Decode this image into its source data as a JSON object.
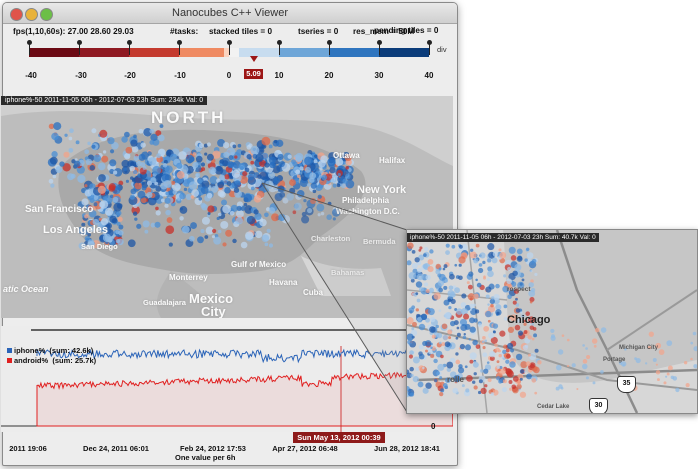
{
  "window": {
    "title": "Nanocubes C++ Viewer"
  },
  "stats": {
    "fps": "fps(1,10,60s): 27.00 28.60 29.03",
    "tasks": "#tasks:",
    "stacked": "stacked tiles = 0",
    "series": "tseries = 0",
    "mem": "res_mem = 50M",
    "pending": "pending tiles = 0"
  },
  "colorbar": {
    "ticks": [
      "-40",
      "-30",
      "-20",
      "-10",
      "0",
      "10",
      "20",
      "30",
      "40"
    ],
    "current_value": "5.09",
    "unit": "div",
    "neg_color": "#6b0a14",
    "pos_color": "#0b3c7a"
  },
  "map": {
    "header": "iphone%-50    2011-11-05 06h - 2012-07-03 23h  Sum: 234k  Val: 0",
    "labels": {
      "north": "NORTH",
      "sf": "San Francisco",
      "la": "Los Angeles",
      "sd": "San Diego",
      "ny": "New York",
      "phil": "Philadelphia",
      "wdc": "Washington D.C.",
      "ottawa": "Ottawa",
      "charleston": "Charleston",
      "bermuda": "Bermuda",
      "bahamas": "Bahamas",
      "monterrey": "Monterrey",
      "havana": "Havana",
      "mexico": "Mexico",
      "city": "City",
      "guadalajara": "Guadalajara",
      "cuba": "Cuba",
      "gulf": "Gulf of Mexico",
      "halifax": "Halifax",
      "ocean": "atic Ocean"
    }
  },
  "timeseries": {
    "legend": [
      {
        "name": "iphone%",
        "sum": "(sum: 42.6k)",
        "color": "#2b64b8"
      },
      {
        "name": "android%",
        "sum": "(sum: 25.7k)",
        "color": "#e02020"
      }
    ],
    "zero_label": "0",
    "x_ticks": [
      "2011 19:06",
      "Dec 24, 2011 06:01",
      "Feb 24, 2012 17:53",
      "Apr 27, 2012 06:48",
      "Jun 28, 2012 18:41"
    ],
    "highlight": "Sun May 13, 2012 00:39",
    "resolution": "One value per 6h"
  },
  "zoom": {
    "header": "iphone%-50    2011-11-05 06h - 2012-07-03 23h  Sum: 40.7k  Val: 0",
    "city": "Chicago",
    "labels": {
      "prospect": "rospect",
      "michigan_city": "Michigan City",
      "portage": "Portage",
      "cedar_lake": "Cedar Lake",
      "rolle": "rolle"
    },
    "routes": [
      "35",
      "30"
    ]
  },
  "colors": {
    "accent_red": "#c51b1b",
    "accent_blue": "#1f5fb2",
    "background": "#ededed"
  }
}
